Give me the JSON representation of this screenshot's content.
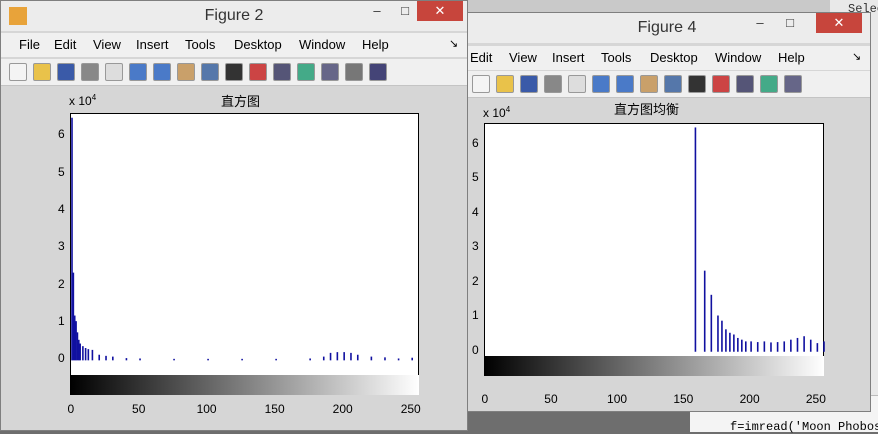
{
  "background": {
    "right_fragments": [
      "Selec",
      "8",
      "8"
    ],
    "code_line": "f=imread('Moon Phobos"
  },
  "figure2": {
    "title": "Figure 2",
    "minimize": "–",
    "maximize": "□",
    "close": "✕",
    "menu": [
      "File",
      "Edit",
      "View",
      "Insert",
      "Tools",
      "Desktop",
      "Window",
      "Help"
    ],
    "menu_arrow": "↘",
    "toolbar_icons": [
      "new-figure-icon",
      "open-file-icon",
      "save-icon",
      "print-icon",
      "pointer-icon",
      "zoom-in-icon",
      "zoom-out-icon",
      "pan-icon",
      "rotate-icon",
      "data-cursor-icon",
      "brush-icon",
      "link-icon",
      "colorbar-icon",
      "legend-icon",
      "hide-tools-icon",
      "show-tools-icon"
    ],
    "plot_title": "直方图",
    "multiplier": "x 10",
    "multiplier_exp": "4",
    "y_ticks": [
      "6",
      "5",
      "4",
      "3",
      "2",
      "1",
      "0"
    ],
    "x_ticks": [
      "0",
      "50",
      "100",
      "150",
      "200",
      "250"
    ]
  },
  "figure4": {
    "title": "Figure 4",
    "minimize": "–",
    "maximize": "□",
    "close": "✕",
    "menu": [
      "Edit",
      "View",
      "Insert",
      "Tools",
      "Desktop",
      "Window",
      "Help"
    ],
    "menu_arrow": "↘",
    "toolbar_icons": [
      "save-icon",
      "print-icon",
      "pointer-icon",
      "zoom-in-icon",
      "zoom-out-icon",
      "pan-icon",
      "rotate-icon",
      "data-cursor-icon",
      "brush-icon",
      "link-icon",
      "colorbar-icon",
      "legend-icon",
      "hide-tools-icon",
      "show-tools-icon"
    ],
    "plot_title": "直方图均衡",
    "multiplier": "x 10",
    "multiplier_exp": "4",
    "y_ticks": [
      "6",
      "5",
      "4",
      "3",
      "2",
      "1",
      "0"
    ],
    "x_ticks": [
      "0",
      "50",
      "100",
      "150",
      "200",
      "250"
    ]
  },
  "chart_data": [
    {
      "type": "bar",
      "title": "直方图",
      "xlabel": "",
      "ylabel": "",
      "xlim": [
        0,
        255
      ],
      "ylim": [
        -0.5,
        6.6
      ],
      "y_multiplier": "x 10^4",
      "x": [
        0,
        1,
        2,
        3,
        4,
        5,
        6,
        8,
        10,
        12,
        15,
        20,
        25,
        30,
        40,
        50,
        75,
        100,
        125,
        150,
        175,
        185,
        190,
        195,
        200,
        205,
        210,
        220,
        230,
        240,
        250
      ],
      "values": [
        6.5,
        2.35,
        1.2,
        1.05,
        0.75,
        0.55,
        0.45,
        0.38,
        0.33,
        0.3,
        0.28,
        0.15,
        0.12,
        0.1,
        0.06,
        0.05,
        0.04,
        0.04,
        0.04,
        0.04,
        0.05,
        0.1,
        0.2,
        0.22,
        0.22,
        0.2,
        0.15,
        0.1,
        0.08,
        0.05,
        0.07
      ],
      "colorbar": "gray"
    },
    {
      "type": "bar",
      "title": "直方图均衡",
      "xlabel": "",
      "ylabel": "",
      "xlim": [
        0,
        255
      ],
      "ylim": [
        -0.5,
        6.6
      ],
      "y_multiplier": "x 10^4",
      "x": [
        158,
        165,
        170,
        175,
        178,
        181,
        184,
        187,
        190,
        193,
        196,
        200,
        205,
        210,
        215,
        220,
        225,
        230,
        235,
        240,
        245,
        250,
        255
      ],
      "values": [
        6.5,
        2.35,
        1.65,
        1.05,
        0.9,
        0.65,
        0.55,
        0.5,
        0.4,
        0.35,
        0.3,
        0.3,
        0.28,
        0.3,
        0.27,
        0.28,
        0.3,
        0.35,
        0.4,
        0.45,
        0.35,
        0.25,
        0.3
      ],
      "colorbar": "gray"
    }
  ]
}
